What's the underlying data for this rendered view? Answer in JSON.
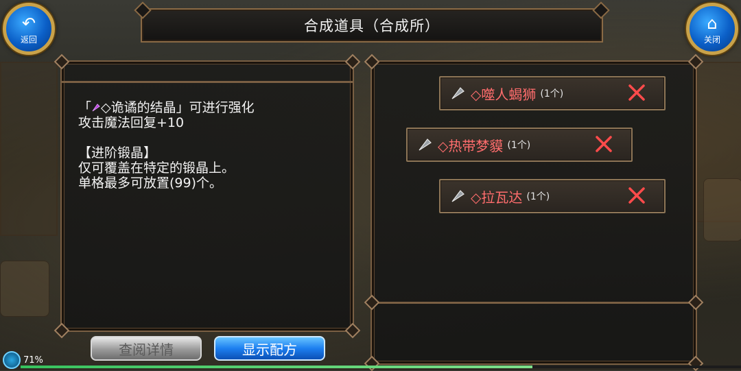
{
  "window": {
    "title": "合成道具（合成所）"
  },
  "corner_buttons": {
    "back": {
      "label": "返回",
      "icon": "back-arrow-icon"
    },
    "close": {
      "label": "关闭",
      "icon": "home-icon"
    }
  },
  "description": {
    "line1_prefix": "「",
    "line1_item": "◇诡谲的结晶」可进行强化",
    "line2": "攻击魔法回复+10",
    "line3": "【进阶锻晶】",
    "line4": "仅可覆盖在特定的锻晶上。",
    "line5": "单格最多可放置(99)个。",
    "item_icon": "purple-crystal-icon"
  },
  "materials": [
    {
      "name": "◇噬人蝎狮",
      "qty": "(1个)",
      "icon": "grey-crystal-icon"
    },
    {
      "name": "◇热带梦貘",
      "qty": "(1个)",
      "icon": "grey-crystal-icon"
    },
    {
      "name": "◇拉瓦达",
      "qty": "(1个)",
      "icon": "grey-crystal-icon"
    }
  ],
  "buttons": {
    "detail": "查阅详情",
    "recipe": "显示配方"
  },
  "status": {
    "battery_label": "71%",
    "progress": 0.71
  },
  "colors": {
    "material_name": "#ff6d6d",
    "remove_x": "#ff4b4b",
    "recipe_button": "#1d7ff0",
    "frame": "#7a5f43"
  }
}
